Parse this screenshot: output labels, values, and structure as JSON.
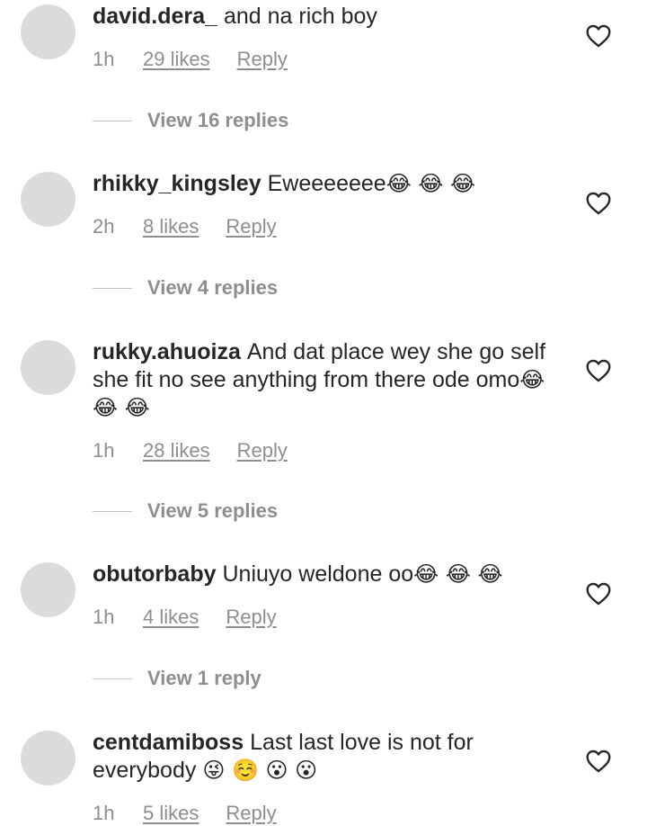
{
  "comments": [
    {
      "username": "david.dera_",
      "text": "and na rich boy",
      "emoji": "",
      "time": "1h",
      "likes": "29 likes",
      "reply": "Reply",
      "view_replies": "View 16 replies"
    },
    {
      "username": "rhikky_kingsley",
      "text": "Eweeeeeee",
      "emoji": "😂 😂 😂",
      "time": "2h",
      "likes": "8 likes",
      "reply": "Reply",
      "view_replies": "View 4 replies"
    },
    {
      "username": "rukky.ahuoiza",
      "text": "And dat place wey she go self she fit no see anything from there ode omo",
      "emoji": "😂 😂 😂",
      "time": "1h",
      "likes": "28 likes",
      "reply": "Reply",
      "view_replies": "View 5 replies"
    },
    {
      "username": "obutorbaby",
      "text": "Uniuyo weldone oo",
      "emoji": "😂 😂 😂",
      "time": "1h",
      "likes": "4 likes",
      "reply": "Reply",
      "view_replies": "View 1 reply"
    },
    {
      "username": "centdamiboss",
      "text": "Last last love is not for everybody",
      "emoji": "😜 ☺️ 😮 😮",
      "time": "1h",
      "likes": "5 likes",
      "reply": "Reply",
      "view_replies": ""
    }
  ],
  "icons": {
    "like": "heart-outline-icon"
  },
  "colors": {
    "text": "#262626",
    "secondary": "#8e8e8e",
    "avatar": "#dbdbdb"
  }
}
